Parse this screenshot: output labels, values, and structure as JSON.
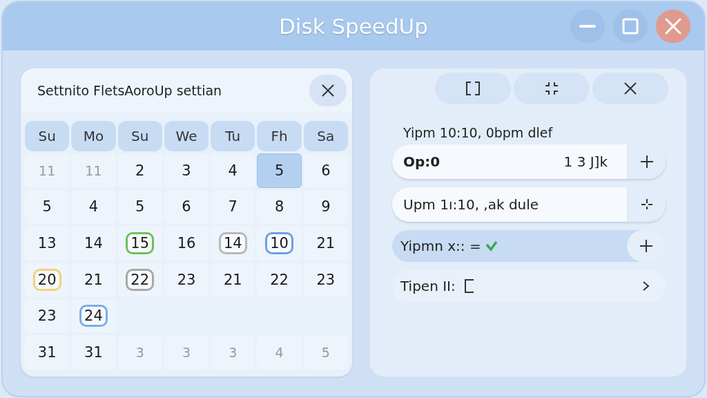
{
  "window": {
    "title": "Disk SpeedUp"
  },
  "calendar": {
    "title": "Settnito FletsAoroUp settian",
    "weekdays": [
      "Su",
      "Mo",
      "Su",
      "We",
      "Tu",
      "Fh",
      "Sa"
    ],
    "weeks": [
      [
        {
          "day": "11",
          "muted": true,
          "selected": false
        },
        {
          "day": "11",
          "muted": true,
          "selected": false
        },
        {
          "day": "2",
          "muted": false,
          "selected": false
        },
        {
          "day": "3",
          "muted": false,
          "selected": false
        },
        {
          "day": "4",
          "muted": false,
          "selected": false
        },
        {
          "day": "5",
          "muted": false,
          "selected": true
        },
        {
          "day": "6",
          "muted": false,
          "selected": false
        }
      ],
      [
        {
          "day": "5",
          "muted": false,
          "selected": false
        },
        {
          "day": "4",
          "muted": false,
          "selected": false
        },
        {
          "day": "5",
          "muted": false,
          "selected": false
        },
        {
          "day": "6",
          "muted": false,
          "selected": false
        },
        {
          "day": "7",
          "muted": false,
          "selected": false
        },
        {
          "day": "8",
          "muted": false,
          "selected": false
        },
        {
          "day": "9",
          "muted": false,
          "selected": false
        }
      ],
      [
        {
          "day": "13",
          "muted": false,
          "selected": false
        },
        {
          "day": "14",
          "muted": false,
          "selected": false
        },
        {
          "day": "15",
          "muted": false,
          "selected": false,
          "color": "#6fbf5a"
        },
        {
          "day": "16",
          "muted": false,
          "selected": false
        },
        {
          "day": "14",
          "muted": false,
          "selected": false,
          "color": "#b8b8b8"
        },
        {
          "day": "10",
          "muted": false,
          "selected": false,
          "color": "#6f9ee0"
        },
        {
          "day": "21",
          "muted": false,
          "selected": false
        }
      ],
      [
        {
          "day": "20",
          "muted": false,
          "selected": false,
          "color": "#f2d27a"
        },
        {
          "day": "21",
          "muted": false,
          "selected": false
        },
        {
          "day": "22",
          "muted": false,
          "selected": false,
          "color": "#a8a8a8"
        },
        {
          "day": "23",
          "muted": false,
          "selected": false
        },
        {
          "day": "21",
          "muted": false,
          "selected": false
        },
        {
          "day": "22",
          "muted": false,
          "selected": false
        },
        {
          "day": "23",
          "muted": false,
          "selected": false
        }
      ],
      [
        {
          "day": "23",
          "muted": false,
          "selected": false
        },
        {
          "day": "24",
          "muted": false,
          "selected": false,
          "color": "#7aaee6"
        }
      ],
      [
        {
          "day": "31",
          "muted": false,
          "selected": false
        },
        {
          "day": "31",
          "muted": false,
          "selected": false
        },
        {
          "day": "3",
          "muted": true,
          "selected": false
        },
        {
          "day": "3",
          "muted": true,
          "selected": false
        },
        {
          "day": "3",
          "muted": true,
          "selected": false
        },
        {
          "day": "4",
          "muted": true,
          "selected": false
        },
        {
          "day": "5",
          "muted": true,
          "selected": false
        }
      ]
    ]
  },
  "panel": {
    "heading": "Yipm 10:10, 0bpm dlef",
    "rows": [
      {
        "kind": "field",
        "label": "Op:0",
        "value": "1 3 J]k"
      },
      {
        "kind": "field",
        "label": "Upm 1ı:10, ,ak dule"
      },
      {
        "kind": "check",
        "label": "Yipmn x:: ="
      },
      {
        "kind": "link",
        "label": "Tipen II:"
      }
    ]
  }
}
